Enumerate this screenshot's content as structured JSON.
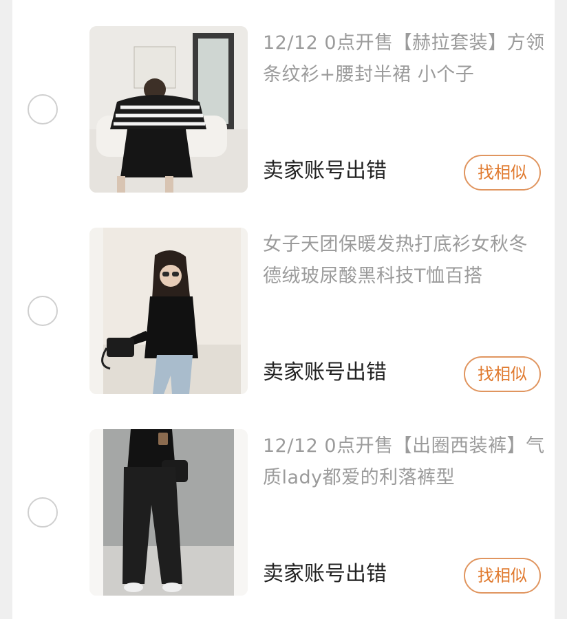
{
  "items": [
    {
      "title": "12/12 0点开售【赫拉套装】方领条纹衫+腰封半裙 小个子",
      "status": "卖家账号出错",
      "button_label": "找相似"
    },
    {
      "title": "女子天团保暖发热打底衫女秋冬德绒玻尿酸黑科技T恤百搭",
      "status": "卖家账号出错",
      "button_label": "找相似"
    },
    {
      "title": "12/12 0点开售【出圈西装裤】气质lady都爱的利落裤型",
      "status": "卖家账号出错",
      "button_label": "找相似"
    }
  ],
  "colors": {
    "accent": "#e07a2f",
    "title_gray": "#9b9b9b",
    "status_text": "#222222"
  }
}
